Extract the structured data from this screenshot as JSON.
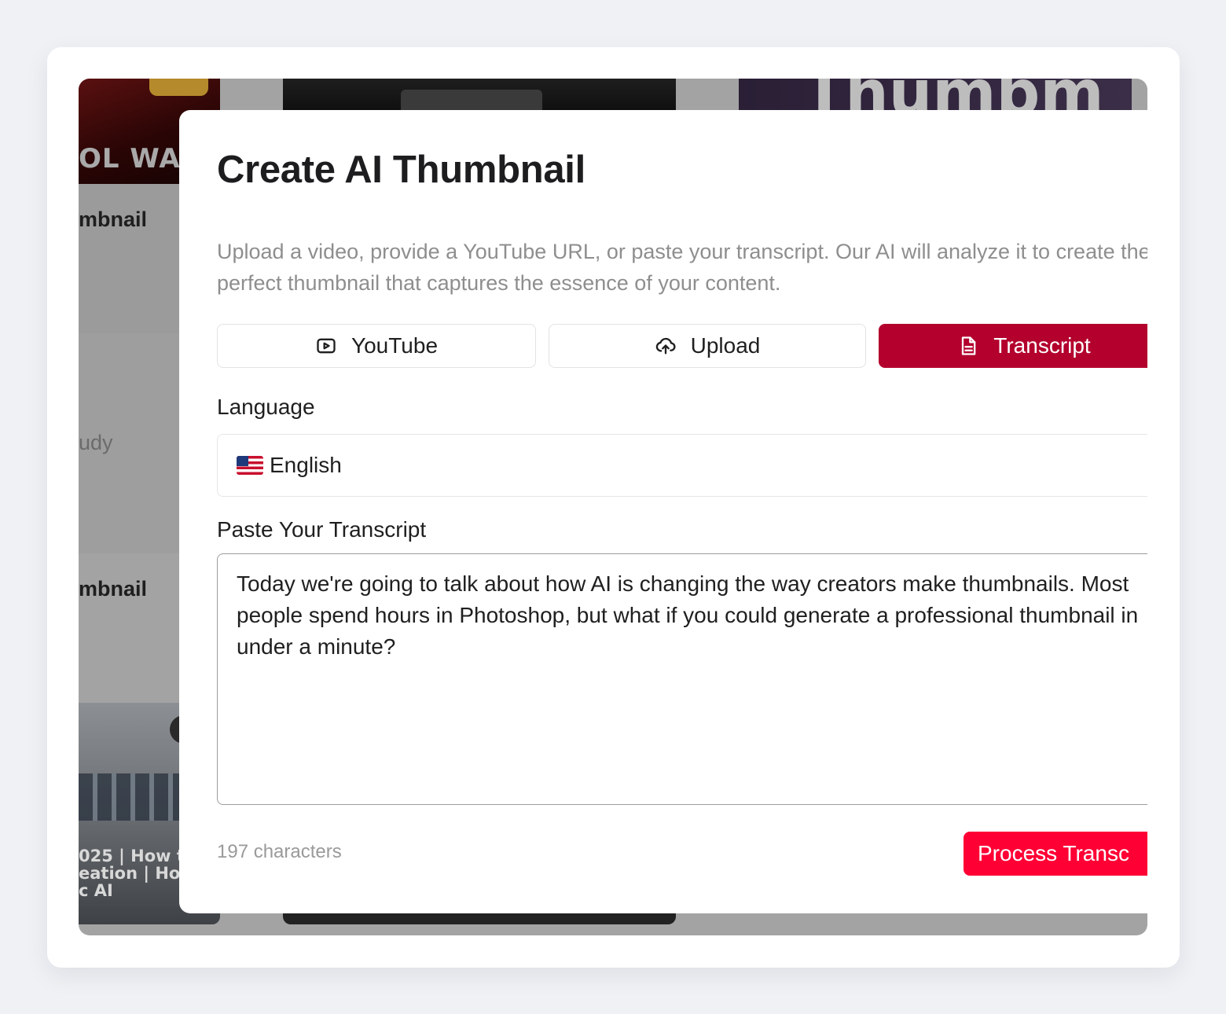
{
  "background": {
    "left_card_war_text": "OL WAR",
    "left_card_title_1": "mbnail",
    "left_card_muted": "udy",
    "left_card_title_2": "mbnail",
    "left_card_caption_lines": [
      "025 | How t",
      "eation | Ho",
      "c AI"
    ],
    "right_thumb_text": "Thumbm"
  },
  "modal": {
    "title": "Create AI Thumbnail",
    "description": "Upload a video, provide a YouTube URL, or paste your transcript. Our AI will analyze it to create the perfect thumbnail that captures the essence of your content.",
    "tabs": [
      {
        "label": "YouTube",
        "icon": "play-box-icon",
        "active": false
      },
      {
        "label": "Upload",
        "icon": "cloud-upload-icon",
        "active": false
      },
      {
        "label": "Transcript",
        "icon": "document-icon",
        "active": true
      }
    ],
    "language": {
      "label": "Language",
      "selected": "English",
      "flag": "us-flag"
    },
    "transcript": {
      "label": "Paste Your Transcript",
      "value": "Today we're going to talk about how AI is changing the way creators make thumbnails. Most people spend hours in Photoshop, but what if you could generate a professional thumbnail in under a minute?",
      "char_count": "197 characters"
    },
    "process_button": "Process Transc"
  },
  "colors": {
    "accent_active_tab": "#b3002d",
    "process_button": "#ff0035",
    "page_background": "#eff1f5",
    "overlay": "#a3a3a3"
  }
}
